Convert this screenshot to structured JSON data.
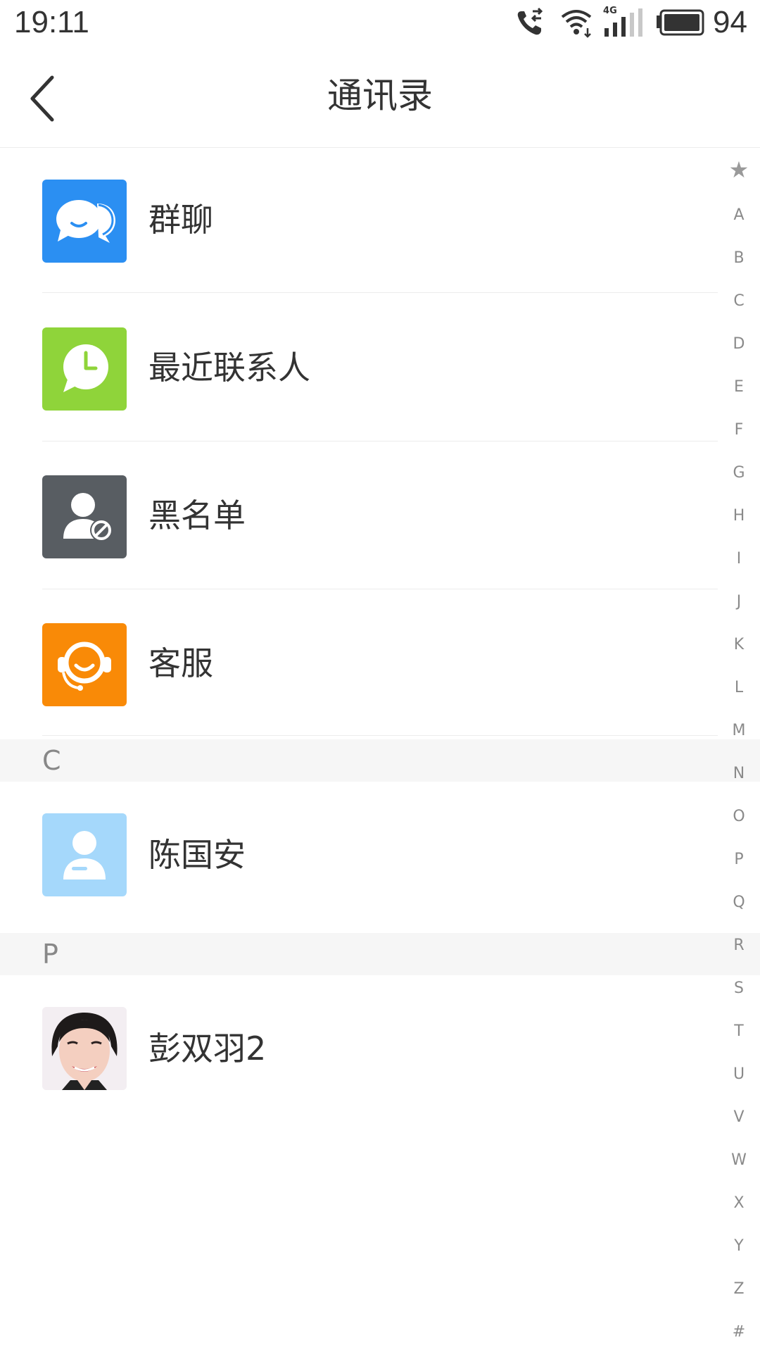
{
  "status_bar": {
    "time": "19:11",
    "battery_percent": "94",
    "signal_label": "4G",
    "icons": [
      "call-forwarding-icon",
      "wifi-icon",
      "cellular-signal-icon",
      "battery-icon"
    ]
  },
  "header": {
    "title": "通讯录",
    "back_icon": "chevron-left-icon"
  },
  "menu": {
    "items": [
      {
        "label": "群聊",
        "icon": "group-chat-icon",
        "color": "#2b8ff2"
      },
      {
        "label": "最近联系人",
        "icon": "recent-clock-icon",
        "color": "#8fd43a"
      },
      {
        "label": "黑名单",
        "icon": "blocked-user-icon",
        "color": "#585d62"
      },
      {
        "label": "客服",
        "icon": "customer-service-icon",
        "color": "#f98a07"
      }
    ]
  },
  "sections": [
    {
      "letter": "C",
      "contacts": [
        {
          "name": "陈国安",
          "avatar": "default-avatar-icon",
          "color": "#a5d8fb"
        }
      ]
    },
    {
      "letter": "P",
      "contacts": [
        {
          "name": "彭双羽2",
          "avatar": "photo-avatar"
        }
      ]
    }
  ],
  "index_bar": {
    "letters": [
      "★",
      "A",
      "B",
      "C",
      "D",
      "E",
      "F",
      "G",
      "H",
      "I",
      "J",
      "K",
      "L",
      "M",
      "N",
      "O",
      "P",
      "Q",
      "R",
      "S",
      "T",
      "U",
      "V",
      "W",
      "X",
      "Y",
      "Z",
      "#"
    ]
  }
}
